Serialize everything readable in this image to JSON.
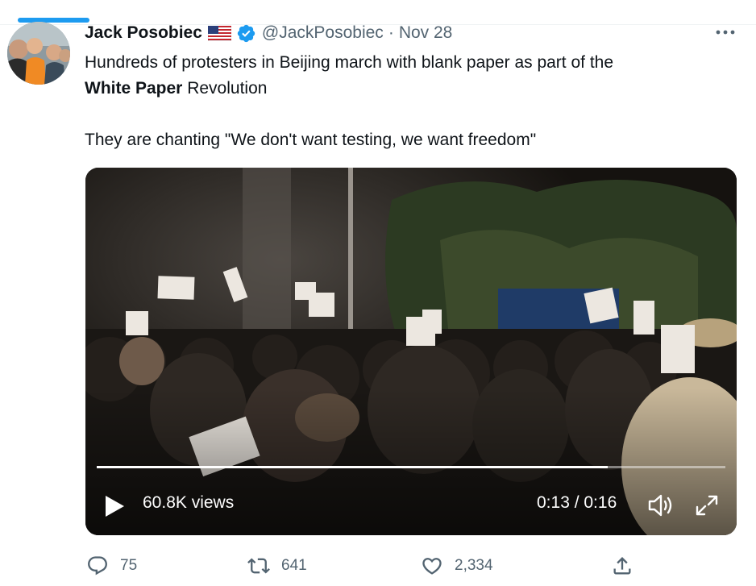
{
  "tweet": {
    "author_name": "Jack Posobiec",
    "handle": "@JackPosobiec",
    "separator": "·",
    "date": "Nov 28",
    "text_line1": "Hundreds of protesters in Beijing march with blank paper as part of the",
    "text_bold": "White Paper",
    "text_after_bold": " Revolution",
    "text_line3": "They are chanting \"We don't want testing, we want freedom\""
  },
  "video": {
    "views": "60.8K views",
    "time": "0:13 / 0:16",
    "progress_fraction": 0.8125
  },
  "actions": {
    "replies": "75",
    "retweets": "641",
    "likes": "2,334"
  },
  "icons": {
    "flag": "us-flag-icon",
    "verified": "verified-badge-icon",
    "more": "more-icon",
    "play": "play-icon",
    "volume": "volume-icon",
    "fullscreen": "fullscreen-icon",
    "reply": "reply-icon",
    "retweet": "retweet-icon",
    "like": "like-icon",
    "share": "share-icon"
  },
  "colors": {
    "accent": "#1d9bf0",
    "text": "#0f1419",
    "secondary": "#536471"
  }
}
